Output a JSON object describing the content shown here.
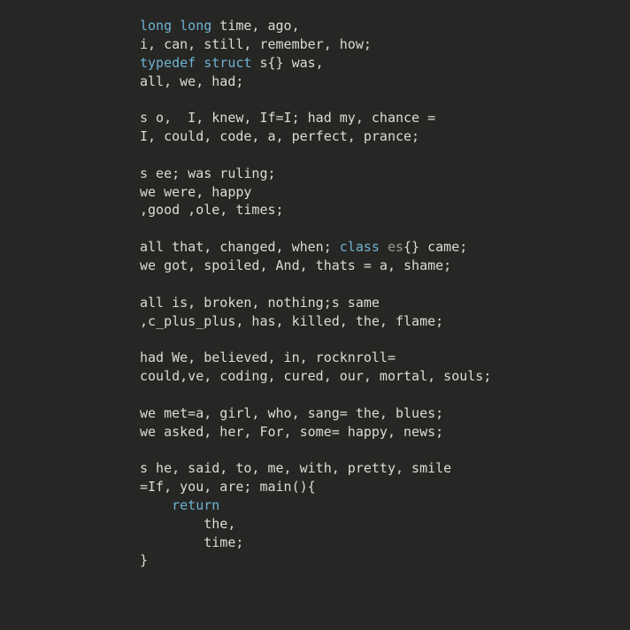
{
  "colors": {
    "background": "#262624",
    "text": "#dcdcd6",
    "keyword": "#6fb3d2",
    "dim": "#9a9a92"
  },
  "editor": {
    "lines": [
      [
        {
          "t": "long long",
          "k": "kw"
        },
        {
          "t": " time, ago,",
          "k": "plain"
        }
      ],
      [
        {
          "t": "i, can, still, remember, how;",
          "k": "plain"
        }
      ],
      [
        {
          "t": "typedef struct",
          "k": "kw"
        },
        {
          "t": " s{} was,",
          "k": "plain"
        }
      ],
      [
        {
          "t": "all, we, had;",
          "k": "plain"
        }
      ],
      [],
      [
        {
          "t": "s o,  I, knew, If=I; had my, chance =",
          "k": "plain"
        }
      ],
      [
        {
          "t": "I, could, code, a, perfect, prance;",
          "k": "plain"
        }
      ],
      [],
      [
        {
          "t": "s ee; was ruling;",
          "k": "plain"
        }
      ],
      [
        {
          "t": "we were, happy",
          "k": "plain"
        }
      ],
      [
        {
          "t": ",good ,ole, times;",
          "k": "plain"
        }
      ],
      [],
      [
        {
          "t": "all that, changed, when; ",
          "k": "plain"
        },
        {
          "t": "class",
          "k": "kw"
        },
        {
          "t": " es",
          "k": "dim"
        },
        {
          "t": "{} came;",
          "k": "plain"
        }
      ],
      [
        {
          "t": "we got, spoiled, And, thats = a, shame;",
          "k": "plain"
        }
      ],
      [],
      [
        {
          "t": "all is, broken, nothing;s same",
          "k": "plain"
        }
      ],
      [
        {
          "t": ",c_plus_plus, has, killed, the, flame;",
          "k": "plain"
        }
      ],
      [],
      [
        {
          "t": "had We, believed, in, rocknroll=",
          "k": "plain"
        }
      ],
      [
        {
          "t": "could,ve, coding, cured, our, mortal, souls;",
          "k": "plain"
        }
      ],
      [],
      [
        {
          "t": "we met=a, girl, who, sang= the, blues;",
          "k": "plain"
        }
      ],
      [
        {
          "t": "we asked, her, For, some= happy, news;",
          "k": "plain"
        }
      ],
      [],
      [
        {
          "t": "s he, said, to, me, with, pretty, smile",
          "k": "plain"
        }
      ],
      [
        {
          "t": "=If, you, are; main(){",
          "k": "plain"
        }
      ],
      [
        {
          "t": "    ",
          "k": "plain"
        },
        {
          "t": "return",
          "k": "kw"
        }
      ],
      [
        {
          "t": "        the,",
          "k": "plain"
        }
      ],
      [
        {
          "t": "        time;",
          "k": "plain"
        }
      ],
      [
        {
          "t": "}",
          "k": "plain"
        }
      ]
    ]
  }
}
